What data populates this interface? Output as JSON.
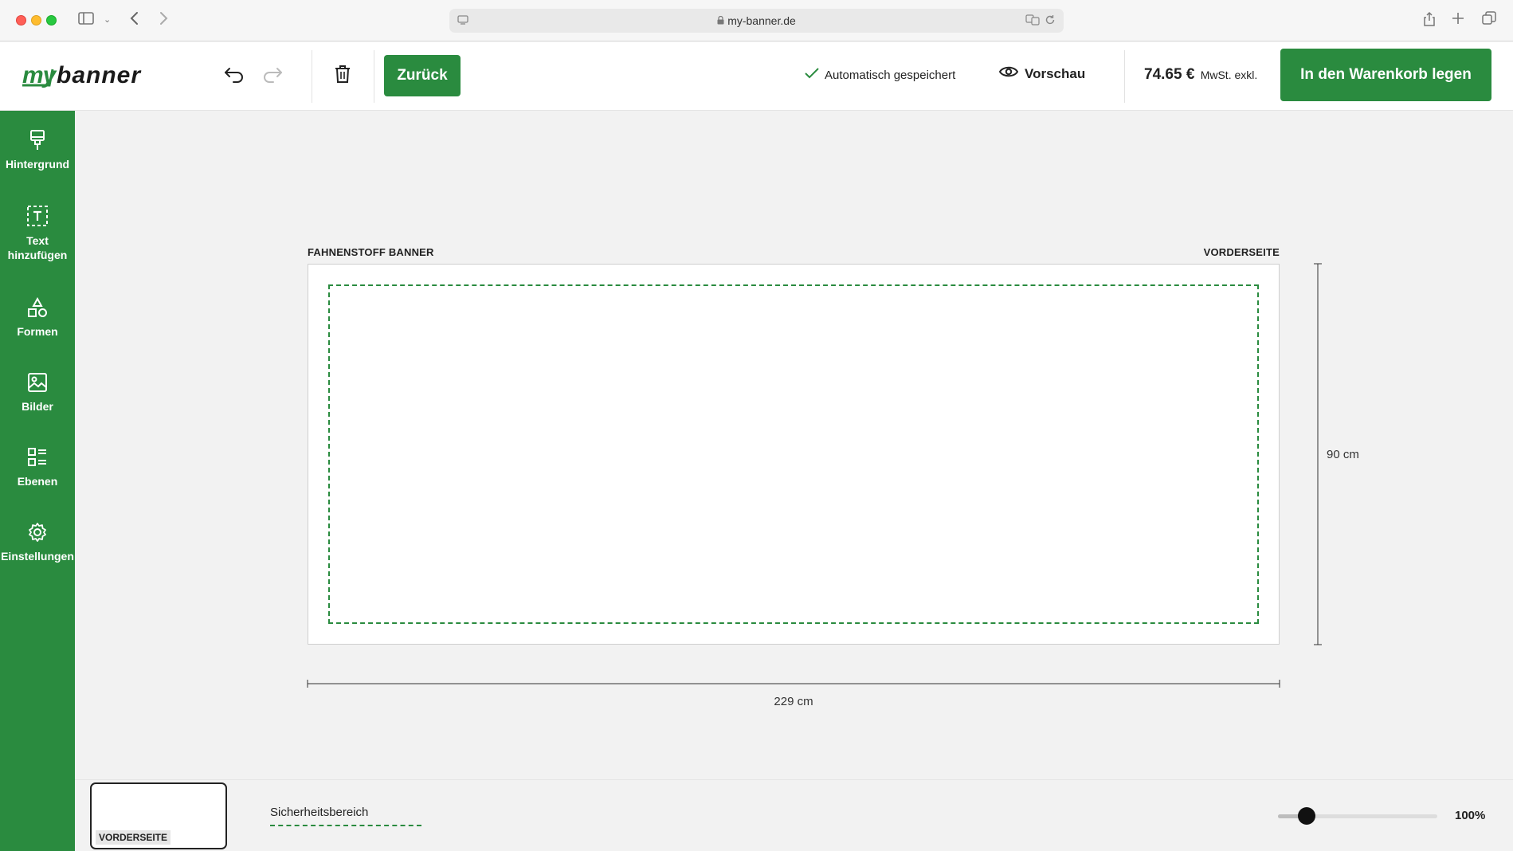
{
  "browser": {
    "url": "my-banner.de"
  },
  "header": {
    "logo_text": "mybanner",
    "back_label": "Zurück",
    "autosave_label": "Automatisch gespeichert",
    "preview_label": "Vorschau",
    "price": "74.65 €",
    "price_tax_note": "MwSt. exkl.",
    "cart_label": "In den Warenkorb legen"
  },
  "sidebar": {
    "items": [
      {
        "label": "Hintergrund",
        "icon": "brush-icon"
      },
      {
        "label": "Text hinzufügen",
        "icon": "text-box-icon"
      },
      {
        "label": "Formen",
        "icon": "shapes-icon"
      },
      {
        "label": "Bilder",
        "icon": "image-icon"
      },
      {
        "label": "Ebenen",
        "icon": "layers-icon"
      },
      {
        "label": "Einstellungen",
        "icon": "gear-icon"
      }
    ]
  },
  "canvas": {
    "product_label": "FAHNENSTOFF BANNER",
    "side_label": "VORDERSEITE",
    "height_label": "90 cm",
    "width_label": "229 cm"
  },
  "bottombar": {
    "thumb_label": "VORDERSEITE",
    "safety_label": "Sicherheitsbereich",
    "zoom_label": "100%",
    "zoom_fraction": 0.18
  },
  "colors": {
    "brand_green": "#2a8b3f"
  }
}
